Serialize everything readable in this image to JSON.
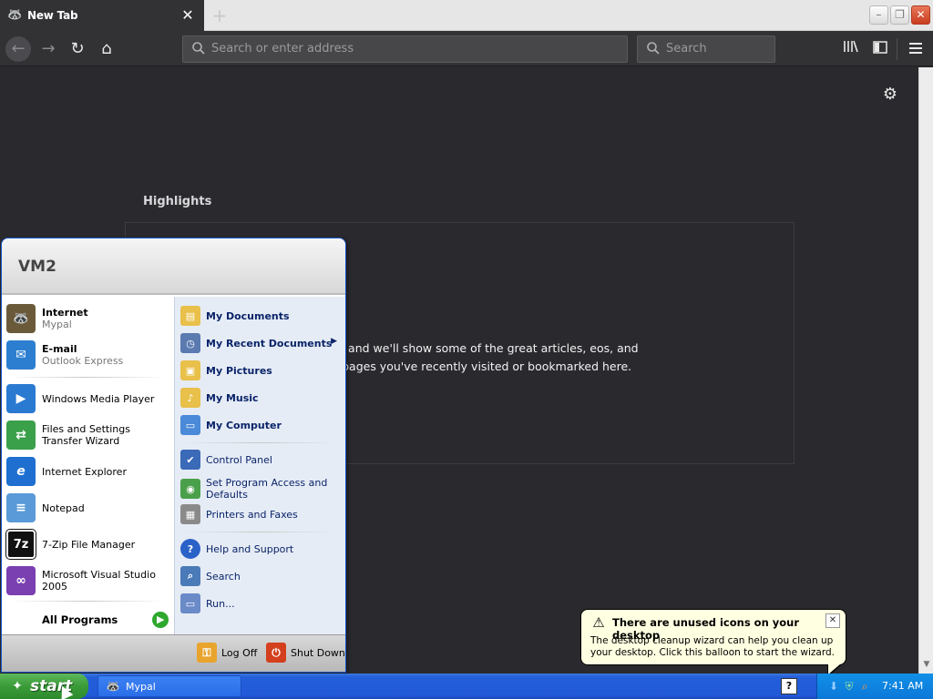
{
  "browser": {
    "tab": {
      "title": "New Tab",
      "icon": "mypal-raccoon-icon",
      "close_glyph": "✕"
    },
    "new_tab_glyph": "+",
    "window_controls": {
      "minimize": "–",
      "maximize": "❐",
      "close": "✕"
    },
    "nav": {
      "back_glyph": "←",
      "forward_glyph": "→",
      "reload_glyph": "↻",
      "home_glyph": "⌂"
    },
    "urlbar": {
      "placeholder": "Search or enter address",
      "value": ""
    },
    "searchbar": {
      "placeholder": "Search",
      "value": ""
    },
    "tools": {
      "library_glyph": "|||\\",
      "sidebar_glyph": "◧",
      "menu_glyph": "☰"
    }
  },
  "newtab": {
    "settings_glyph": "⚙",
    "highlights_title": "Highlights",
    "highlights_message": "owsing, and we'll show some of the great articles, eos, and other pages you've recently visited or bookmarked here."
  },
  "start_menu": {
    "username": "VM2",
    "pinned": [
      {
        "label": "Internet",
        "sublabel": "Mypal",
        "icon": "mypal-raccoon-icon",
        "color": "#6b5a3a"
      },
      {
        "label": "E-mail",
        "sublabel": "Outlook Express",
        "icon": "outlook-express-icon",
        "color": "#2c7fd0"
      }
    ],
    "recent": [
      {
        "label": "Windows Media Player",
        "icon": "media-player-icon",
        "color": "#2a7ad2",
        "glyph": "▶"
      },
      {
        "label": "Files and Settings Transfer Wizard",
        "icon": "transfer-wizard-icon",
        "color": "#3aa04a",
        "glyph": "⇄"
      },
      {
        "label": "Internet Explorer",
        "icon": "internet-explorer-icon",
        "color": "#1e6fd0",
        "glyph": "e"
      },
      {
        "label": "Notepad",
        "icon": "notepad-icon",
        "color": "#5a9ad8",
        "glyph": "≡"
      },
      {
        "label": "7-Zip File Manager",
        "icon": "seven-zip-icon",
        "color": "#111111",
        "glyph": "7z"
      },
      {
        "label": "Microsoft Visual Studio 2005",
        "icon": "visual-studio-icon",
        "color": "#7a3fb0",
        "glyph": "∞"
      }
    ],
    "all_programs_label": "All Programs",
    "all_programs_glyph": "▶",
    "places": [
      {
        "label": "My Documents",
        "icon": "my-documents-icon",
        "color": "#e8c04a",
        "glyph": "▤",
        "bold": true
      },
      {
        "label": "My Recent Documents",
        "icon": "recent-documents-icon",
        "color": "#5a7ab0",
        "glyph": "◷",
        "bold": true,
        "submenu": true
      },
      {
        "label": "My Pictures",
        "icon": "my-pictures-icon",
        "color": "#e8c04a",
        "glyph": "▣",
        "bold": true
      },
      {
        "label": "My Music",
        "icon": "my-music-icon",
        "color": "#e8c04a",
        "glyph": "♪",
        "bold": true
      },
      {
        "label": "My Computer",
        "icon": "my-computer-icon",
        "color": "#4a8ad8",
        "glyph": "▭",
        "bold": true
      }
    ],
    "system": [
      {
        "label": "Control Panel",
        "icon": "control-panel-icon",
        "color": "#3a6ab8",
        "glyph": "✔"
      },
      {
        "label": "Set Program Access and Defaults",
        "icon": "program-defaults-icon",
        "color": "#4aa04a",
        "glyph": "◉"
      },
      {
        "label": "Printers and Faxes",
        "icon": "printer-icon",
        "color": "#8a8a8a",
        "glyph": "▦"
      }
    ],
    "support": [
      {
        "label": "Help and Support",
        "icon": "help-icon",
        "color": "#2a62c8",
        "glyph": "?"
      },
      {
        "label": "Search",
        "icon": "search-icon",
        "color": "#4a7ab8",
        "glyph": "⌕"
      },
      {
        "label": "Run...",
        "icon": "run-icon",
        "color": "#6a8ac8",
        "glyph": "▭"
      }
    ],
    "submenu_arrow": "▶",
    "logoff_label": "Log Off",
    "logoff_glyph": "⚿",
    "shutdown_label": "Shut Down",
    "shutdown_glyph": "⏻"
  },
  "taskbar": {
    "start_label": "start",
    "start_logo": "✦",
    "tasks": [
      {
        "label": "Mypal",
        "icon": "mypal-raccoon-icon"
      }
    ],
    "quicklaunch_glyph": "?",
    "tray": {
      "network_glyph": "⬇",
      "security_glyph": "⛨",
      "search_glyph": "⌕"
    },
    "clock": "7:41 AM"
  },
  "balloon": {
    "title": "There are unused icons on your desktop",
    "body": "The desktop cleanup wizard can help you clean up your desktop. Click this balloon to start the wizard.",
    "warn_glyph": "⚠",
    "close_glyph": "✕"
  }
}
